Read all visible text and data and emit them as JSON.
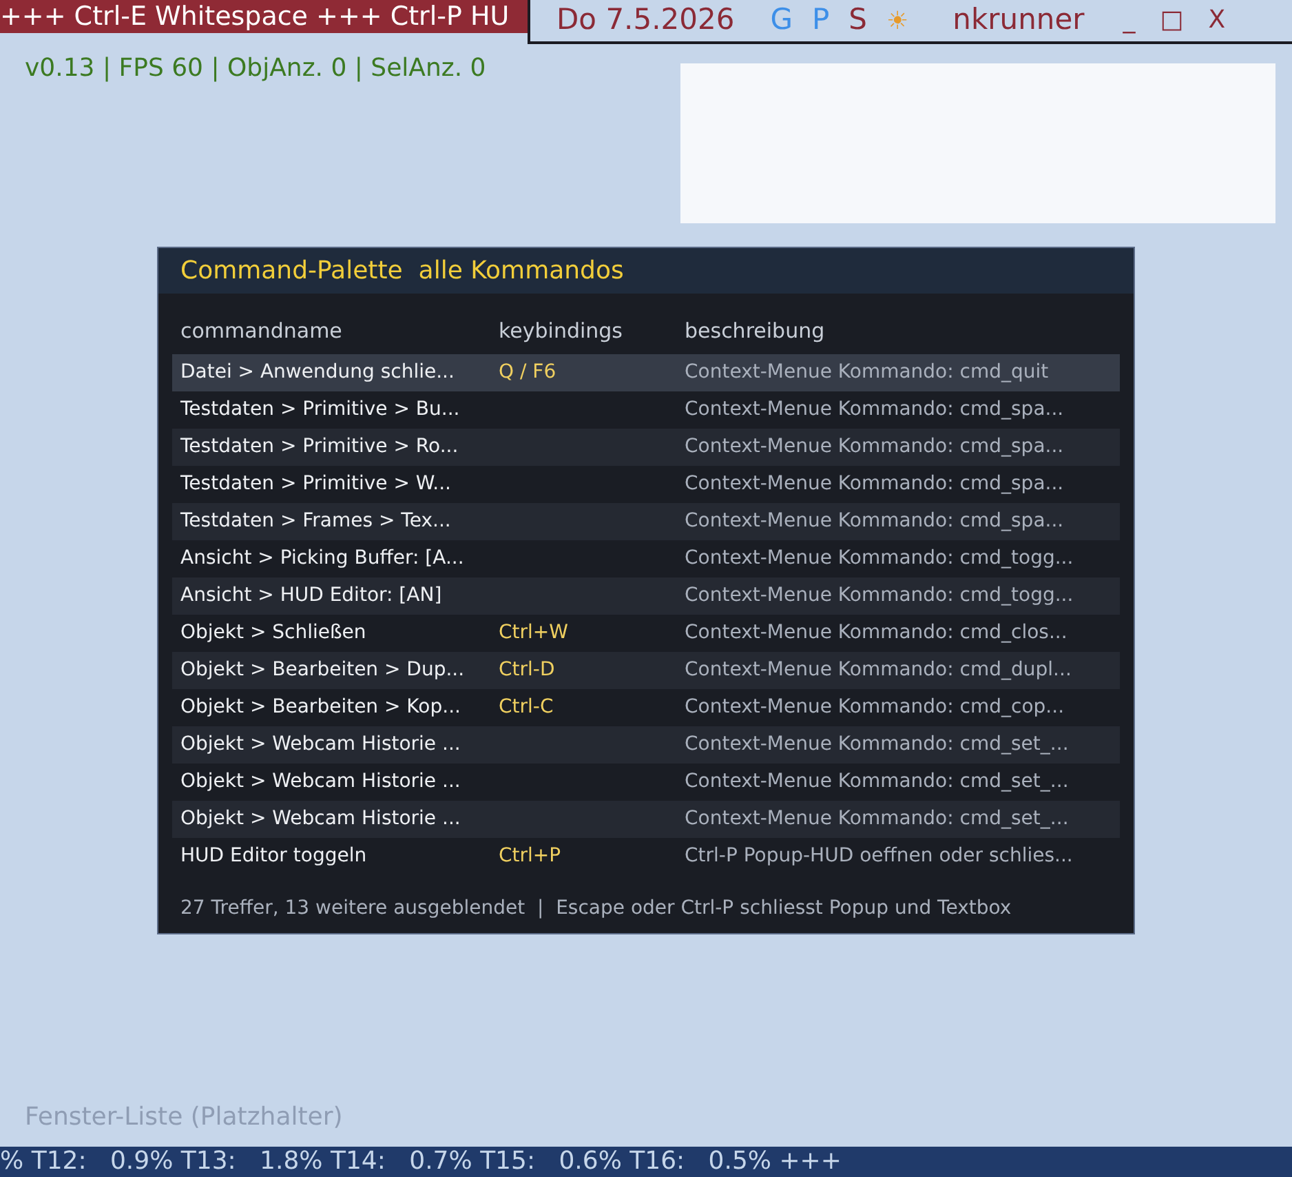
{
  "top_ticker": "+++ Ctrl-E Whitespace +++ Ctrl-P HU",
  "top_panel": {
    "date": "Do 7.5.2026",
    "indicators": [
      {
        "label": "G",
        "color": "#3d8fe8"
      },
      {
        "label": "P",
        "color": "#3d8fe8"
      },
      {
        "label": "S",
        "color": "#8b2a36"
      }
    ],
    "weather": "☀",
    "user": "nkrunner",
    "window_buttons": [
      "_",
      "□",
      "X"
    ]
  },
  "stats": "v0.13 | FPS 60 | ObjAnz. 0 | SelAnz. 0",
  "palette": {
    "title": "Command-Palette  alle Kommandos",
    "columns": [
      "commandname",
      "keybindings",
      "beschreibung"
    ],
    "rows": [
      {
        "name": "Datei > Anwendung schlie...",
        "keys": "Q / F6",
        "description": "Context-Menue Kommando: cmd_quit",
        "selected": true
      },
      {
        "name": "Testdaten > Primitive > Bu...",
        "keys": "",
        "description": "Context-Menue Kommando: cmd_spa...",
        "selected": false
      },
      {
        "name": "Testdaten > Primitive > Ro...",
        "keys": "",
        "description": "Context-Menue Kommando: cmd_spa...",
        "selected": false
      },
      {
        "name": "Testdaten > Primitive > W...",
        "keys": "",
        "description": "Context-Menue Kommando: cmd_spa...",
        "selected": false
      },
      {
        "name": "Testdaten > Frames > Tex...",
        "keys": "",
        "description": "Context-Menue Kommando: cmd_spa...",
        "selected": false
      },
      {
        "name": "Ansicht > Picking Buffer: [A...",
        "keys": "",
        "description": "Context-Menue Kommando: cmd_togg...",
        "selected": false
      },
      {
        "name": "Ansicht > HUD Editor: [AN]",
        "keys": "",
        "description": "Context-Menue Kommando: cmd_togg...",
        "selected": false
      },
      {
        "name": "Objekt > Schließen",
        "keys": "Ctrl+W",
        "description": "Context-Menue Kommando: cmd_clos...",
        "selected": false
      },
      {
        "name": "Objekt > Bearbeiten > Dup...",
        "keys": "Ctrl-D",
        "description": "Context-Menue Kommando: cmd_dupl...",
        "selected": false
      },
      {
        "name": "Objekt > Bearbeiten > Kop...",
        "keys": "Ctrl-C",
        "description": "Context-Menue Kommando: cmd_cop...",
        "selected": false
      },
      {
        "name": "Objekt > Webcam Historie ...",
        "keys": "",
        "description": "Context-Menue Kommando: cmd_set_...",
        "selected": false
      },
      {
        "name": "Objekt > Webcam Historie ...",
        "keys": "",
        "description": "Context-Menue Kommando: cmd_set_...",
        "selected": false
      },
      {
        "name": "Objekt > Webcam Historie ...",
        "keys": "",
        "description": "Context-Menue Kommando: cmd_set_...",
        "selected": false
      },
      {
        "name": "HUD Editor toggeln",
        "keys": "Ctrl+P",
        "description": "Ctrl-P Popup-HUD oeffnen oder schlies...",
        "selected": false
      }
    ],
    "footer": "27 Treffer, 13 weitere ausgeblendet  |  Escape oder Ctrl-P schliesst Popup und Textbox"
  },
  "window_list": "Fenster-Liste (Platzhalter)",
  "status_bar": "% T12:   0.9% T13:   1.8% T14:   0.7% T15:   0.6% T16:   0.5% +++"
}
